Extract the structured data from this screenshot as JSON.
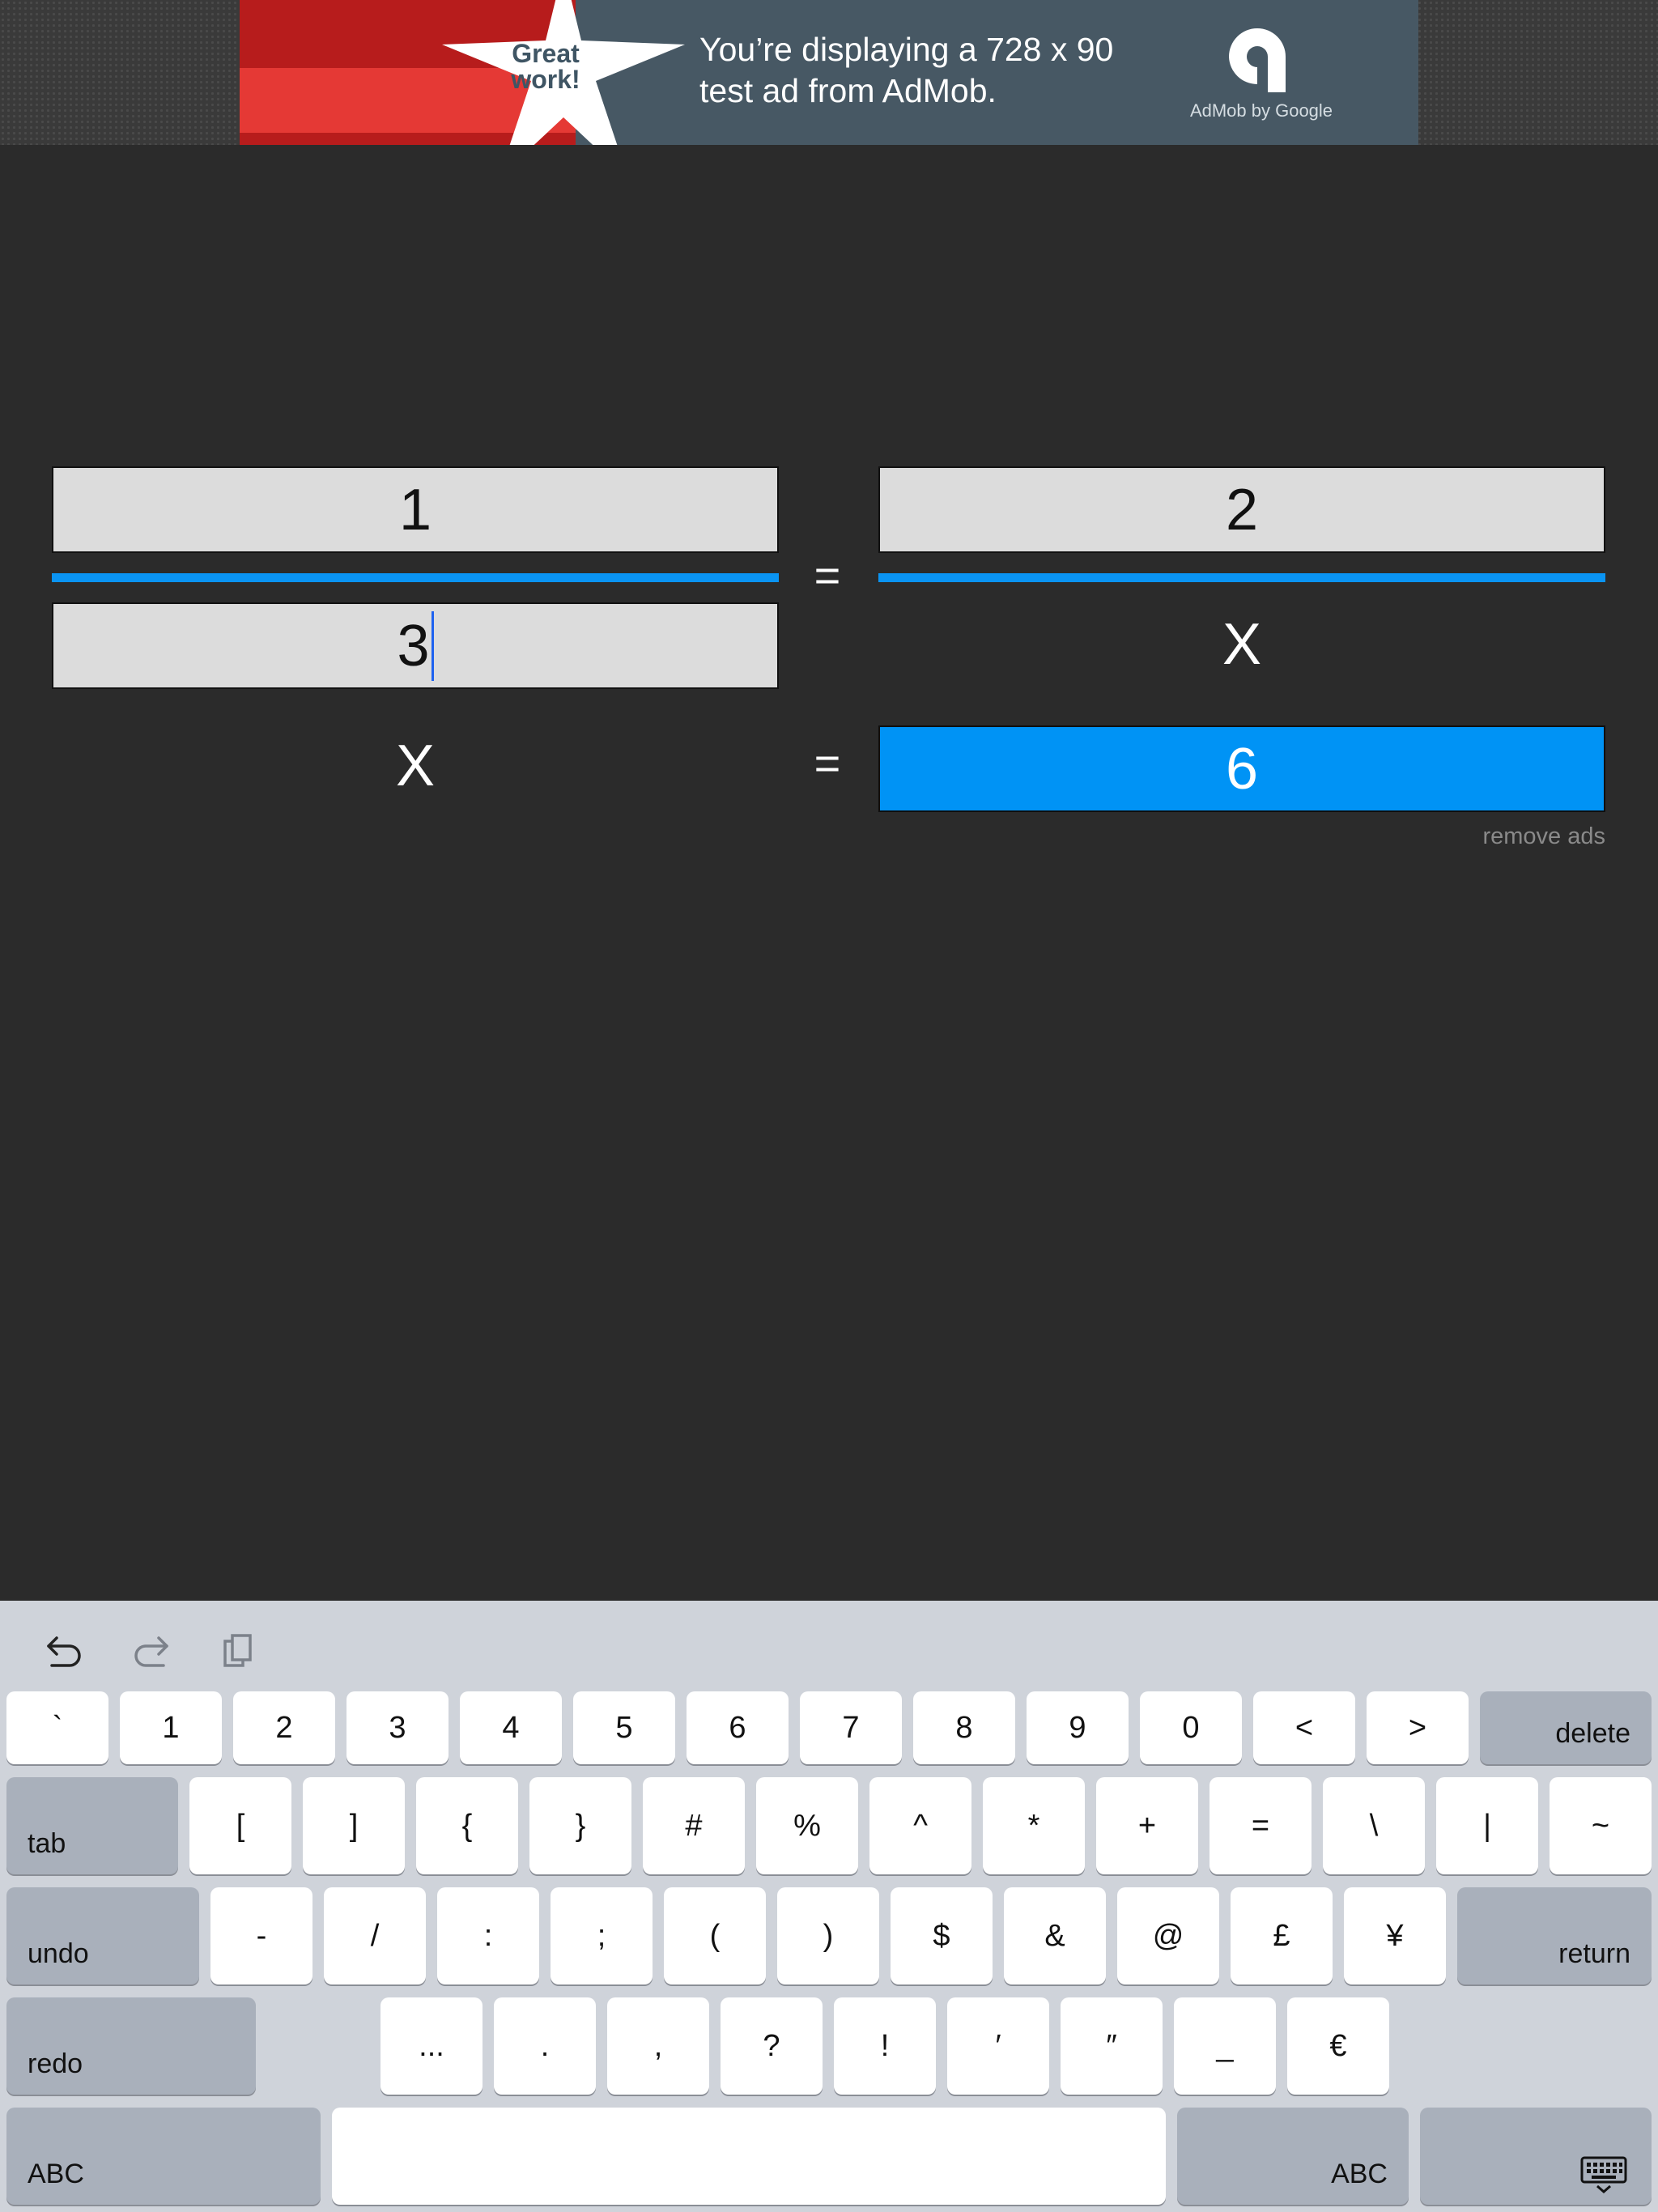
{
  "ad": {
    "badge_line1": "Great",
    "badge_line2": "work!",
    "message_line1": "You’re displaying a 728 x 90",
    "message_line2": "test ad from AdMob.",
    "brand": "AdMob by Google",
    "colors": {
      "background": "#475864",
      "red_dark": "#b71c1c",
      "red_light": "#e53935"
    }
  },
  "proportion": {
    "top_left": "1",
    "bottom_left": "3",
    "top_right": "2",
    "bottom_right_symbol": "X",
    "eq_symbol": "=",
    "result_symbol": "X",
    "result_eq": "=",
    "result_value": "6",
    "colors": {
      "bar": "#0a94f3",
      "result_bg": "#0093f5",
      "field_bg": "#dcdcdc"
    }
  },
  "remove_ads": "remove ads",
  "keyboard": {
    "toolbar": {
      "undo_icon": "undo-arrow-icon",
      "redo_icon": "redo-arrow-icon",
      "paste_icon": "clipboard-icon"
    },
    "row1": [
      "`",
      "1",
      "2",
      "3",
      "4",
      "5",
      "6",
      "7",
      "8",
      "9",
      "0",
      "<",
      ">"
    ],
    "delete": "delete",
    "tab": "tab",
    "row2": [
      "[",
      "]",
      "{",
      "}",
      "#",
      "%",
      "^",
      "*",
      "+",
      "=",
      "\\",
      "|",
      "~"
    ],
    "undo": "undo",
    "row3": [
      "-",
      "/",
      ":",
      ";",
      "(",
      ")",
      "$",
      "&",
      "@",
      "£",
      "¥"
    ],
    "return": "return",
    "redo": "redo",
    "row4": [
      "...",
      ".",
      ",",
      "?",
      "!",
      "′",
      "″",
      "_",
      "€"
    ],
    "abc_left": "ABC",
    "abc_right": "ABC",
    "hide_icon": "keyboard-dismiss-icon"
  }
}
